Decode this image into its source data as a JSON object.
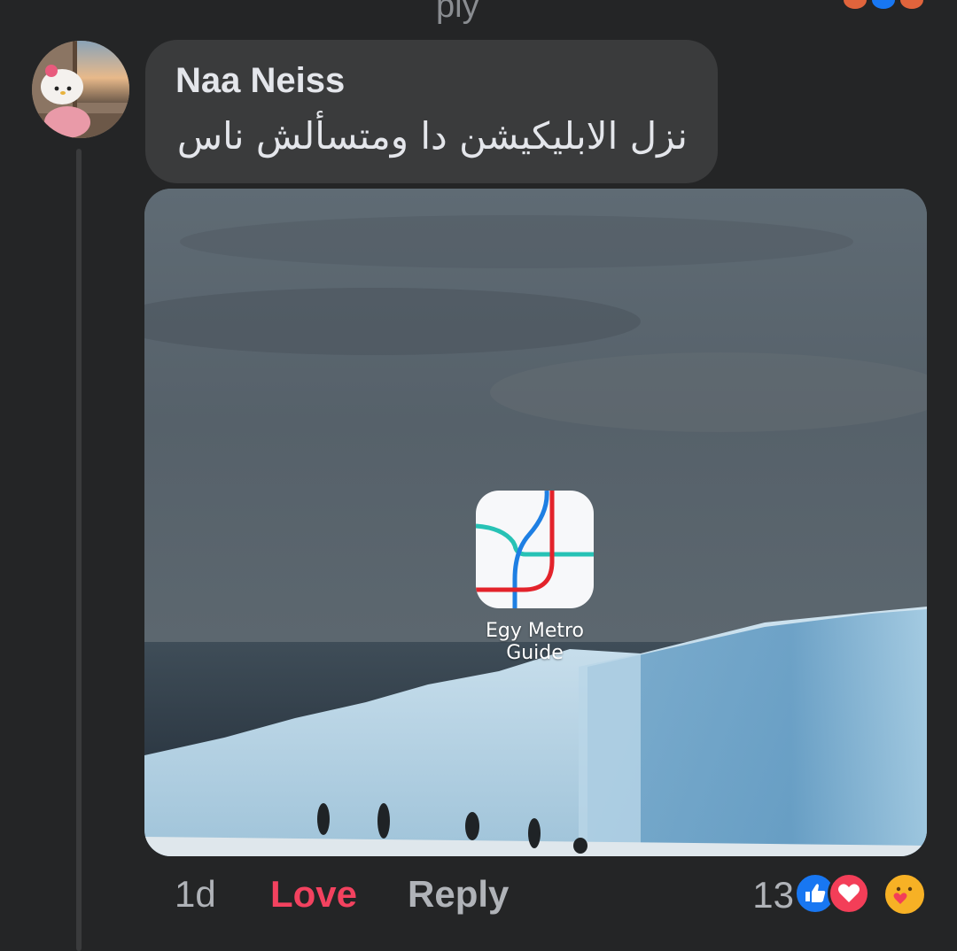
{
  "top": {
    "cut_text": "ply"
  },
  "comment": {
    "author": "Naa Neiss",
    "text": "نزل الابليكيشن دا ومتسألش ناس"
  },
  "image": {
    "app_label_line1": "Egy Metro",
    "app_label_line2": "Guide"
  },
  "actions": {
    "time": "1d",
    "love": "Love",
    "reply": "Reply"
  },
  "reactions": {
    "count": "13",
    "icons": [
      "like-icon",
      "love-icon",
      "care-icon"
    ]
  },
  "colors": {
    "background": "#242526",
    "bubble": "#3a3b3c",
    "love": "#f3425f",
    "like": "#1877f2",
    "heart": "#f33e58",
    "care": "#f7b125"
  }
}
